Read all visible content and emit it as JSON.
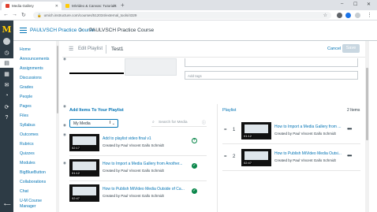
{
  "browser": {
    "tabs": [
      {
        "label": "Media Gallery",
        "favicon_color": "#e03e2d",
        "active": true
      },
      {
        "label": "MiVideo & Canvas: Tutorials - Mi",
        "favicon_color": "#ffcb05",
        "active": false
      }
    ],
    "new_tab": "+",
    "url": "umich.instructure.com/courses/512034/external_tools/4329",
    "window_controls": [
      "–",
      "☐",
      "✕"
    ]
  },
  "global_nav": {
    "logo": "M",
    "icons": [
      "account-icon",
      "dashboard-icon",
      "courses-icon",
      "calendar-icon",
      "inbox-icon",
      "history-icon",
      "commons-icon",
      "help-icon"
    ],
    "collapse": "⟵"
  },
  "course_header": {
    "course_link": "PAULVSCH Practice Course",
    "separator": ">",
    "current": "PAULVSCH Practice Course"
  },
  "course_nav": {
    "items": [
      {
        "label": "Home",
        "hidden": false
      },
      {
        "label": "Announcements",
        "hidden": true
      },
      {
        "label": "Assignments",
        "hidden": false
      },
      {
        "label": "Discussions",
        "hidden": false
      },
      {
        "label": "Grades",
        "hidden": false
      },
      {
        "label": "People",
        "hidden": false
      },
      {
        "label": "Pages",
        "hidden": true
      },
      {
        "label": "Files",
        "hidden": false
      },
      {
        "label": "Syllabus",
        "hidden": true
      },
      {
        "label": "Outcomes",
        "hidden": true
      },
      {
        "label": "Rubrics",
        "hidden": false
      },
      {
        "label": "Quizzes",
        "hidden": false
      },
      {
        "label": "Modules",
        "hidden": true
      },
      {
        "label": "BigBlueButton",
        "hidden": false
      },
      {
        "label": "Collaborations",
        "hidden": false
      },
      {
        "label": "Chat",
        "hidden": false
      },
      {
        "label": "U-M Course",
        "hidden": false
      },
      {
        "label": "Manager",
        "hidden": false
      }
    ]
  },
  "toolbar": {
    "edit_label": "Edit Playlist",
    "playlist_title": "Test1",
    "cancel": "Cancel",
    "save": "Save"
  },
  "form": {
    "tags_placeholder": "Add tags"
  },
  "add_items": {
    "title": "Add Items To Your Playlist",
    "select_value": "My Media",
    "search_placeholder": "Search for Media",
    "media": [
      {
        "title": "Add to playlist video final v1",
        "by": "Created by Paul Vincent Gallo Schmidt",
        "duration": "02:17",
        "added": false
      },
      {
        "title": "How to Import a Media Gallery from Another...",
        "by": "Created by Paul Vincent Gallo Schmidt",
        "duration": "01:12",
        "added": true
      },
      {
        "title": "How to Publish MiVideo Media Outside of Ca...",
        "by": "Created by Paul Vincent Gallo Schmidt",
        "duration": "02:47",
        "added": true
      }
    ]
  },
  "playlist": {
    "title": "Playlist",
    "count": "2 Items",
    "items": [
      {
        "num": "1",
        "title": "How to Import a Media Gallery from ...",
        "by": "Created by Paul Vincent Gallo Schmidt",
        "duration": "01:12"
      },
      {
        "num": "2",
        "title": "How to Publish MiVideo Media Outsi...",
        "by": "Created by Paul Vincent Gallo Schmidt",
        "duration": "02:47"
      }
    ]
  },
  "colors": {
    "canvas_nav": "#2d3b45",
    "link": "#0374b5",
    "success": "#0b874b",
    "umich_maize": "#ffcb05"
  }
}
